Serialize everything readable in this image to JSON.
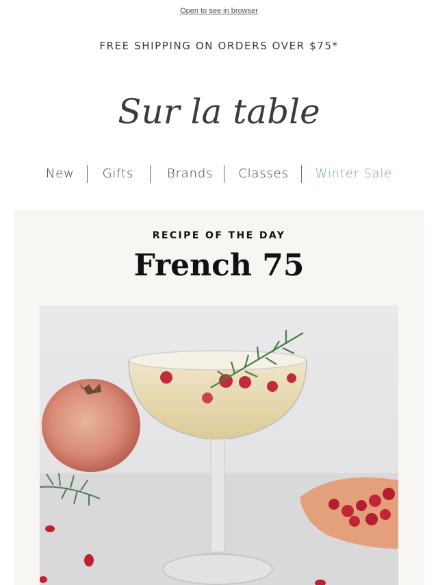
{
  "header": {
    "browser_link": "Open to see in browser",
    "shipping_banner": "FREE SHIPPING ON ORDERS OVER $75*",
    "brand": "Sur la table"
  },
  "nav": {
    "items": [
      {
        "label": "New"
      },
      {
        "label": "Gifts"
      },
      {
        "label": "Brands"
      },
      {
        "label": "Classes"
      },
      {
        "label": "Winter Sale"
      }
    ]
  },
  "feature": {
    "kicker": "RECIPE OF THE DAY",
    "title": "French 75"
  },
  "colors": {
    "sale_accent": "#6aa3bd",
    "card_background": "#f8f6f2"
  }
}
